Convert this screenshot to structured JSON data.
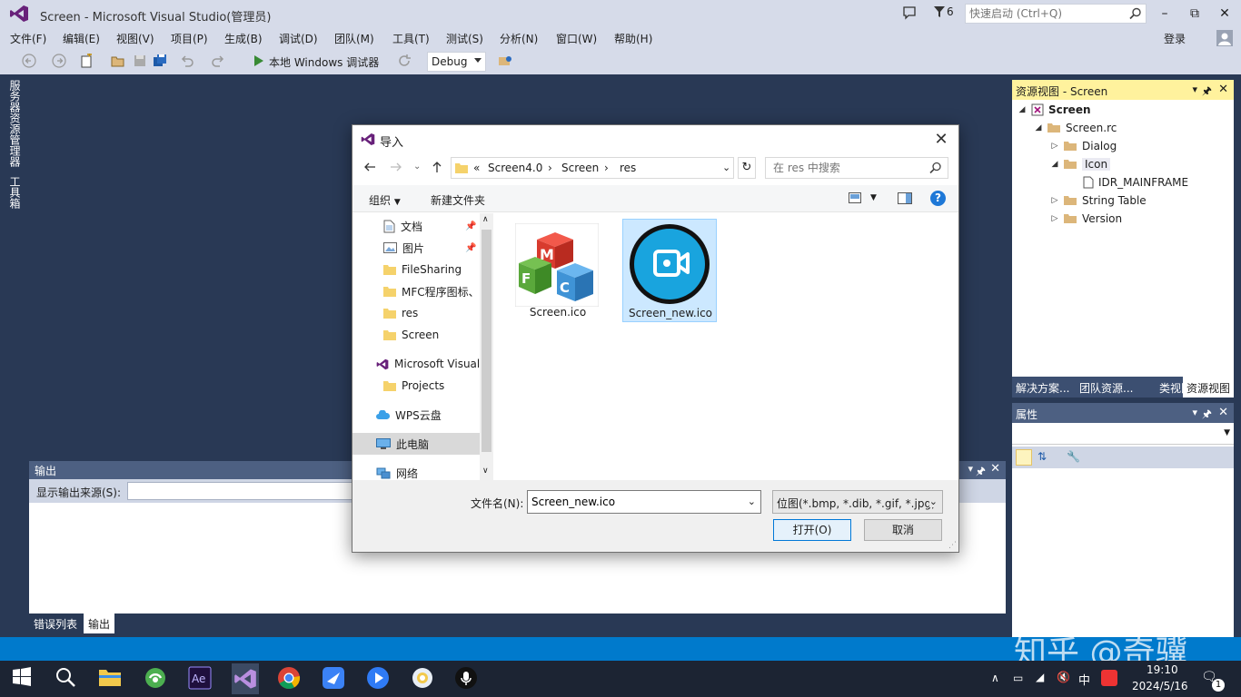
{
  "app": {
    "title": "Screen - Microsoft Visual Studio(管理员)",
    "notification_count": "6",
    "quick_launch_placeholder": "快速启动 (Ctrl+Q)",
    "login": "登录"
  },
  "menu": [
    "文件(F)",
    "编辑(E)",
    "视图(V)",
    "项目(P)",
    "生成(B)",
    "调试(D)",
    "团队(M)",
    "工具(T)",
    "测试(S)",
    "分析(N)",
    "窗口(W)",
    "帮助(H)"
  ],
  "toolbar": {
    "debugger_label": "本地 Windows 调试器",
    "configuration": "Debug"
  },
  "left_strip": {
    "tabs": [
      "服务器资源管理器",
      "工具箱"
    ]
  },
  "output": {
    "title": "输出",
    "source_label": "显示输出来源(S):",
    "tabs": [
      "错误列表",
      "输出"
    ]
  },
  "resource_view": {
    "title": "资源视图 - Screen",
    "tree": [
      {
        "label": "Screen",
        "bold": true
      },
      {
        "label": "Screen.rc"
      },
      {
        "label": "Dialog"
      },
      {
        "label": "Icon"
      },
      {
        "label": "IDR_MAINFRAME"
      },
      {
        "label": "String Table"
      },
      {
        "label": "Version"
      }
    ],
    "tabs": [
      "解决方案...",
      "团队资源...",
      "类视图",
      "资源视图"
    ]
  },
  "properties": {
    "title": "属性"
  },
  "watermark": "知乎 @奇骥",
  "taskbar": {
    "ime": "中",
    "time": "19:10",
    "date": "2024/5/16",
    "notification_badge": "1"
  },
  "dialog": {
    "title": "导入",
    "breadcrumb": [
      "«",
      "Screen4.0",
      "›",
      "Screen",
      "›",
      "res"
    ],
    "search_placeholder": "在 res 中搜索",
    "organize": "组织",
    "new_folder": "新建文件夹",
    "nav_items": [
      {
        "label": "文档",
        "icon": "document-icon",
        "pinned": true
      },
      {
        "label": "图片",
        "icon": "pictures-icon",
        "pinned": true
      },
      {
        "label": "FileSharing",
        "icon": "folder-icon"
      },
      {
        "label": "MFC程序图标、",
        "icon": "folder-icon"
      },
      {
        "label": "res",
        "icon": "folder-icon"
      },
      {
        "label": "Screen",
        "icon": "folder-icon"
      },
      {
        "label": "Microsoft Visual",
        "icon": "vs-icon"
      },
      {
        "label": "Projects",
        "icon": "folder-icon"
      },
      {
        "label": "WPS云盘",
        "icon": "cloud-icon"
      },
      {
        "label": "此电脑",
        "icon": "computer-icon",
        "selected": true
      },
      {
        "label": "网络",
        "icon": "network-icon"
      }
    ],
    "files": [
      {
        "name": "Screen.ico",
        "selected": false
      },
      {
        "name": "Screen_new.ico",
        "selected": true
      }
    ],
    "filename_label": "文件名(N):",
    "filename_value": "Screen_new.ico",
    "filter": "位图(*.bmp, *.dib, *.gif, *.jpg,",
    "open_button": "打开(O)",
    "cancel_button": "取消"
  },
  "colors": {
    "ide_background": "#293955",
    "chrome": "#d6dbe9",
    "status_bar": "#007acc",
    "resource_view_header": "#fff29d",
    "selection": "#cce8ff"
  }
}
